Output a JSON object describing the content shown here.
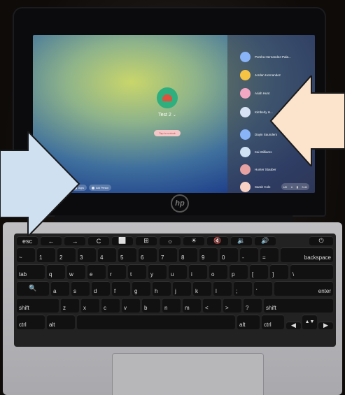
{
  "login": {
    "username": "Test 2",
    "tap_to_unlock": "Tap to unlock"
  },
  "shelf": {
    "apps_label": "Apps",
    "add_person_label": "Add Person"
  },
  "status": {
    "battery": "UK",
    "time": "3:41"
  },
  "users": [
    {
      "name": "Porsha Hernandez-Pala...",
      "color": "#8ab4f8"
    },
    {
      "name": "Jordan Hernandez",
      "color": "#f6c445"
    },
    {
      "name": "Ariah Hunt",
      "color": "#f2a7c3"
    },
    {
      "name": "Kimberly H...",
      "color": "#d7e3f4"
    },
    {
      "name": "Dayin Saunders",
      "color": "#8ab4f8"
    },
    {
      "name": "Kai Williams",
      "color": "#cfe2f3"
    },
    {
      "name": "Hunter Stauber",
      "color": "#e6a2a2"
    },
    {
      "name": "Sarah Cole",
      "color": "#f7d2c4"
    }
  ],
  "keyboard": {
    "row1": [
      "esc",
      "←",
      "→",
      "C",
      "⬜",
      "⊞",
      "☼",
      "☀",
      "🔇",
      "🔉",
      "🔊",
      "⏻"
    ],
    "row2": [
      "~",
      "1",
      "2",
      "3",
      "4",
      "5",
      "6",
      "7",
      "8",
      "9",
      "0",
      "-",
      "=",
      "backspace"
    ],
    "row3": [
      "tab",
      "q",
      "w",
      "e",
      "r",
      "t",
      "y",
      "u",
      "i",
      "o",
      "p",
      "[",
      "]",
      "\\"
    ],
    "row4": [
      "🔍",
      "a",
      "s",
      "d",
      "f",
      "g",
      "h",
      "j",
      "k",
      "l",
      ";",
      "'",
      "enter"
    ],
    "row5": [
      "shift",
      "z",
      "x",
      "c",
      "v",
      "b",
      "n",
      "m",
      "<",
      ">",
      "?",
      "shift"
    ],
    "row6": [
      "ctrl",
      "alt",
      "",
      "alt",
      "ctrl",
      "◀",
      "▲▼",
      "▶"
    ]
  },
  "brand": "hp",
  "colors": {
    "arrow_left": "#cfe0f1",
    "arrow_right": "#fbe3cc",
    "arrow_stroke": "#1a1a1a"
  }
}
